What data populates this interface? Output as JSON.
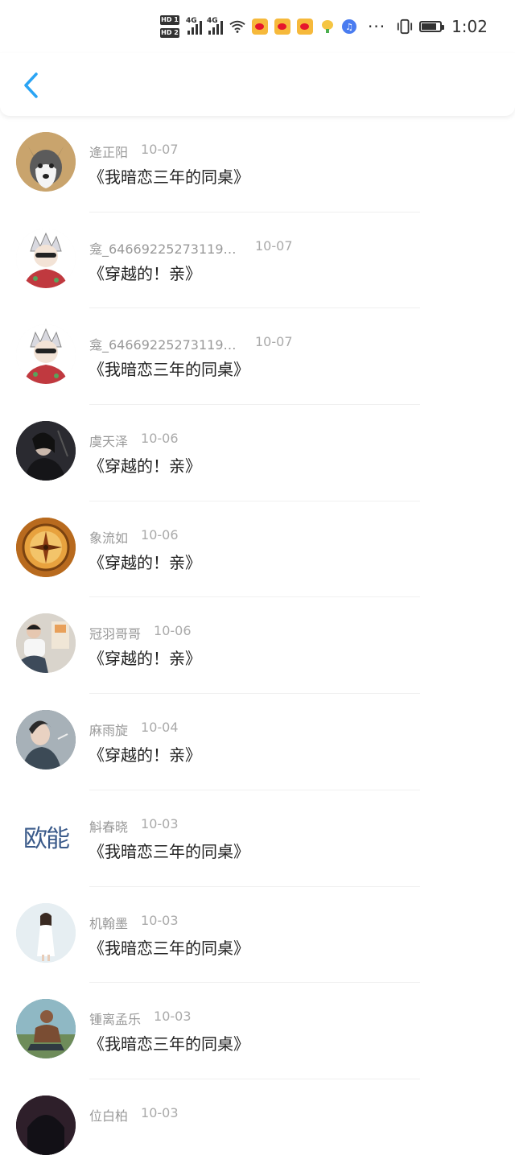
{
  "status_bar": {
    "time": "1:02",
    "hd_labels": [
      "HD 1",
      "HD 2"
    ],
    "network": [
      "4G",
      "4G"
    ]
  },
  "header": {
    "back_icon": "chevron-left-icon",
    "accent_color": "#2aa4f4"
  },
  "rows": [
    {
      "name": "逄正阳",
      "date": "10-07",
      "title": "《我暗恋三年的同桌》",
      "avatar_bg": "#c9a46d"
    },
    {
      "name": "龛_6466922527311915...",
      "date": "10-07",
      "title": "《穿越的！亲》",
      "avatar_bg": "#f1f1f1"
    },
    {
      "name": "龛_6466922527311915...",
      "date": "10-07",
      "title": "《我暗恋三年的同桌》",
      "avatar_bg": "#f1f1f1"
    },
    {
      "name": "虞天泽",
      "date": "10-06",
      "title": "《穿越的！亲》",
      "avatar_bg": "#2a2a30"
    },
    {
      "name": "象流如",
      "date": "10-06",
      "title": "《穿越的！亲》",
      "avatar_bg": "#d4892a"
    },
    {
      "name": "冠羽哥哥",
      "date": "10-06",
      "title": "《穿越的！亲》",
      "avatar_bg": "#d9d4cc"
    },
    {
      "name": "麻雨旋",
      "date": "10-04",
      "title": "《穿越的！亲》",
      "avatar_bg": "#5e6b73"
    },
    {
      "name": "斛春晓",
      "date": "10-03",
      "title": "《我暗恋三年的同桌》",
      "avatar_text": "欧能",
      "avatar_bg": "#ffffff"
    },
    {
      "name": "机翰墨",
      "date": "10-03",
      "title": "《我暗恋三年的同桌》",
      "avatar_bg": "#dfe9ef"
    },
    {
      "name": "锺离孟乐",
      "date": "10-03",
      "title": "《我暗恋三年的同桌》",
      "avatar_bg": "#4a8f9c"
    },
    {
      "name": "位白柏",
      "date": "10-03",
      "title": "",
      "avatar_bg": "#2e1f2a"
    }
  ]
}
